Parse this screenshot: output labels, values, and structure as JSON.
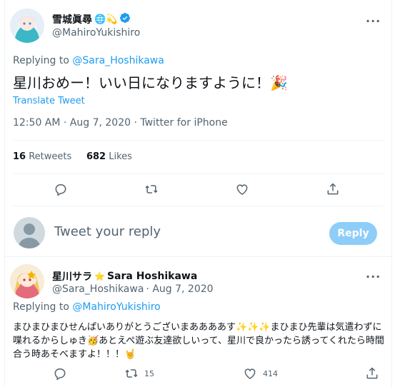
{
  "tweet": {
    "author_name": "雪城眞尋",
    "author_name_emoji": "🌐💫",
    "author_handle": "@MahiroYukishiro",
    "replying_label": "Replying to ",
    "replying_to": "@Sara_Hoshikawa",
    "text": "星川おめー！いい日になりますように！🎉",
    "translate": "Translate Tweet",
    "timestamp": "12:50 AM · Aug 7, 2020 · Twitter for iPhone",
    "retweets_count": "16",
    "retweets_label": "Retweets",
    "likes_count": "682",
    "likes_label": "Likes",
    "more": "···",
    "colors": {
      "accent": "#1d9bf0",
      "verified": "#1d9bf0"
    }
  },
  "compose": {
    "placeholder": "Tweet your reply",
    "button": "Reply",
    "button_color": "#8ecdf8"
  },
  "reply": {
    "author_name": "星川サラ",
    "author_name_star": "⭐",
    "author_name_latin": "Sara Hoshikawa",
    "author_handle": "@Sara_Hoshikawa",
    "date": " · Aug 7, 2020",
    "replying_label": "Replying to ",
    "replying_to": "@MahiroYukishiro",
    "text": "まひまひまひせんぱいありがとうございまああああす✨✨✨まひまひ先輩は気遣わずに喋れるからしゅき🥳あとえぺ遊ぶ友達欲しいって、星川で良かったら誘ってくれたら時間合う時あそべますよ！！！🤘",
    "retweets_count": "15",
    "likes_count": "414",
    "more": "···"
  },
  "icons": {
    "reply": "comment-icon",
    "retweet": "retweet-icon",
    "like": "heart-icon",
    "share": "share-icon",
    "verified": "verified-badge-icon"
  }
}
